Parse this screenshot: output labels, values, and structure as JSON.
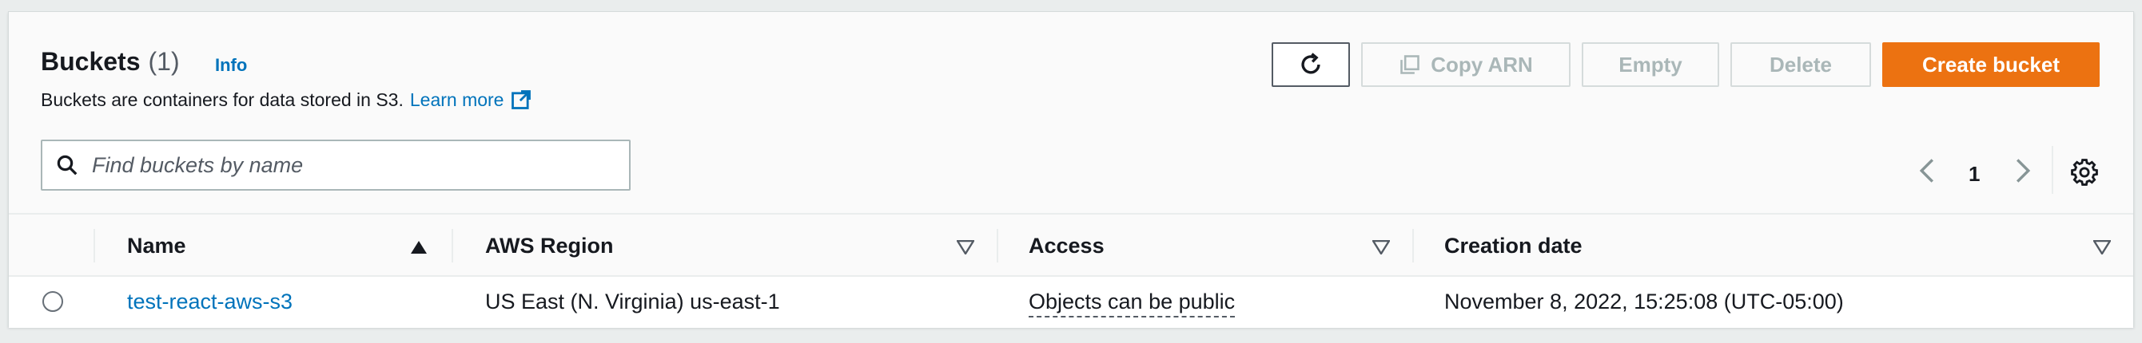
{
  "header": {
    "title": "Buckets",
    "count": "(1)",
    "info_label": "Info",
    "description": "Buckets are containers for data stored in S3.",
    "learn_more": "Learn more"
  },
  "toolbar": {
    "refresh_icon": "refresh-icon",
    "copy_arn_label": "Copy ARN",
    "empty_label": "Empty",
    "delete_label": "Delete",
    "create_label": "Create bucket"
  },
  "search": {
    "placeholder": "Find buckets by name",
    "value": ""
  },
  "pagination": {
    "current_page": "1"
  },
  "table": {
    "columns": [
      "Name",
      "AWS Region",
      "Access",
      "Creation date"
    ],
    "rows": [
      {
        "name": "test-react-aws-s3",
        "region": "US East (N. Virginia) us-east-1",
        "access": "Objects can be public",
        "created": "November 8, 2022, 15:25:08 (UTC-05:00)"
      }
    ]
  },
  "colors": {
    "primary_button": "#ec7211",
    "link": "#0073bb",
    "text": "#16191f",
    "disabled": "#aab7b8"
  }
}
